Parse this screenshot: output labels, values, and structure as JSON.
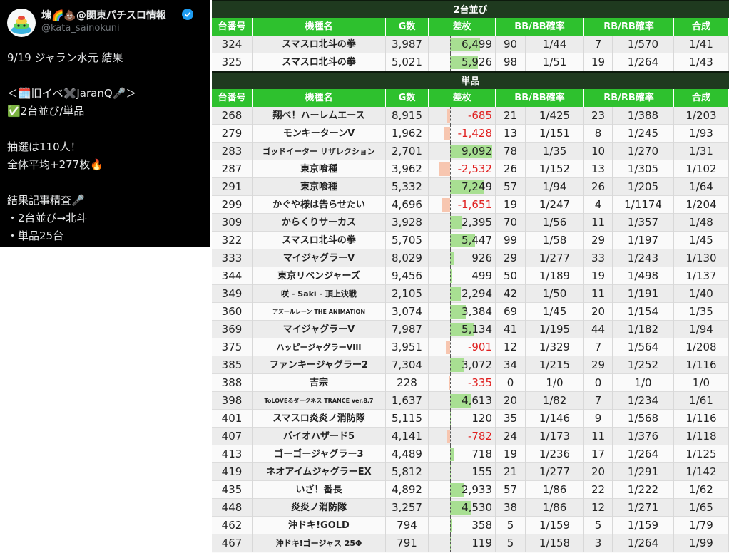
{
  "tweet": {
    "author_name": "塊🌈💩@関東パチスロ情報",
    "handle": "@kata_sainokuni",
    "lines": [
      "9/19 ジャラン水元 結果",
      "",
      "＜🗓️旧イベ✖️JaranQ🎤＞",
      "✅2台並び/単品",
      "",
      "抽選は110人！",
      "全体平均+277枚🔥",
      "",
      "結果記事精査🎤",
      "・2台並び→北斗",
      "・単品25台"
    ]
  },
  "columns": [
    "台番号",
    "機種名",
    "G数",
    "差枚",
    "BB/BB確率",
    "",
    "RB/RB確率",
    "",
    "合成"
  ],
  "sections": [
    {
      "title": "2台並び",
      "rows": [
        {
          "no": "324",
          "name": "スマスロ北斗の拳",
          "g": "3,987",
          "diff": "6,499",
          "diff_value": 6499,
          "bb": "90",
          "bb_rate": "1/44",
          "rb": "7",
          "rb_rate": "1/570",
          "total": "1/41"
        },
        {
          "no": "325",
          "name": "スマスロ北斗の拳",
          "g": "5,021",
          "diff": "5,926",
          "diff_value": 5926,
          "bb": "98",
          "bb_rate": "1/51",
          "rb": "19",
          "rb_rate": "1/264",
          "total": "1/43"
        }
      ]
    },
    {
      "title": "単品",
      "rows": [
        {
          "no": "268",
          "name": "翔べ！ハーレムエース",
          "g": "8,915",
          "diff": "-685",
          "diff_value": -685,
          "bb": "21",
          "bb_rate": "1/425",
          "rb": "23",
          "rb_rate": "1/388",
          "total": "1/203"
        },
        {
          "no": "279",
          "name": "モンキーターンV",
          "g": "1,962",
          "diff": "-1,428",
          "diff_value": -1428,
          "bb": "13",
          "bb_rate": "1/151",
          "rb": "8",
          "rb_rate": "1/245",
          "total": "1/93"
        },
        {
          "no": "283",
          "name": "ゴッドイーター リザレクション",
          "g": "2,701",
          "diff": "9,092",
          "diff_value": 9092,
          "bb": "78",
          "bb_rate": "1/35",
          "rb": "10",
          "rb_rate": "1/270",
          "total": "1/31"
        },
        {
          "no": "287",
          "name": "東京喰種",
          "g": "3,962",
          "diff": "-2,532",
          "diff_value": -2532,
          "bb": "26",
          "bb_rate": "1/152",
          "rb": "13",
          "rb_rate": "1/305",
          "total": "1/102"
        },
        {
          "no": "291",
          "name": "東京喰種",
          "g": "5,332",
          "diff": "7,249",
          "diff_value": 7249,
          "bb": "57",
          "bb_rate": "1/94",
          "rb": "26",
          "rb_rate": "1/205",
          "total": "1/64"
        },
        {
          "no": "299",
          "name": "かぐや様は告らせたい",
          "g": "4,696",
          "diff": "-1,651",
          "diff_value": -1651,
          "bb": "19",
          "bb_rate": "1/247",
          "rb": "4",
          "rb_rate": "1/1174",
          "total": "1/204"
        },
        {
          "no": "309",
          "name": "からくりサーカス",
          "g": "3,928",
          "diff": "2,395",
          "diff_value": 2395,
          "bb": "70",
          "bb_rate": "1/56",
          "rb": "11",
          "rb_rate": "1/357",
          "total": "1/48"
        },
        {
          "no": "322",
          "name": "スマスロ北斗の拳",
          "g": "5,705",
          "diff": "5,447",
          "diff_value": 5447,
          "bb": "99",
          "bb_rate": "1/58",
          "rb": "29",
          "rb_rate": "1/197",
          "total": "1/45"
        },
        {
          "no": "333",
          "name": "マイジャグラーV",
          "g": "8,029",
          "diff": "926",
          "diff_value": 926,
          "bb": "29",
          "bb_rate": "1/277",
          "rb": "33",
          "rb_rate": "1/243",
          "total": "1/130"
        },
        {
          "no": "344",
          "name": "東京リベンジャーズ",
          "g": "9,456",
          "diff": "499",
          "diff_value": 499,
          "bb": "50",
          "bb_rate": "1/189",
          "rb": "19",
          "rb_rate": "1/498",
          "total": "1/137"
        },
        {
          "no": "349",
          "name": "咲 - Saki - 頂上決戦",
          "g": "2,105",
          "diff": "2,294",
          "diff_value": 2294,
          "bb": "42",
          "bb_rate": "1/50",
          "rb": "11",
          "rb_rate": "1/191",
          "total": "1/40"
        },
        {
          "no": "360",
          "name": "アズールレーン THE ANIMATION",
          "g": "3,074",
          "diff": "3,384",
          "diff_value": 3384,
          "bb": "69",
          "bb_rate": "1/45",
          "rb": "20",
          "rb_rate": "1/154",
          "total": "1/35"
        },
        {
          "no": "369",
          "name": "マイジャグラーV",
          "g": "7,987",
          "diff": "5,134",
          "diff_value": 5134,
          "bb": "41",
          "bb_rate": "1/195",
          "rb": "44",
          "rb_rate": "1/182",
          "total": "1/94"
        },
        {
          "no": "375",
          "name": "ハッピージャグラーVIII",
          "g": "3,951",
          "diff": "-901",
          "diff_value": -901,
          "bb": "12",
          "bb_rate": "1/329",
          "rb": "7",
          "rb_rate": "1/564",
          "total": "1/208"
        },
        {
          "no": "385",
          "name": "ファンキージャグラー2",
          "g": "7,304",
          "diff": "3,072",
          "diff_value": 3072,
          "bb": "34",
          "bb_rate": "1/215",
          "rb": "29",
          "rb_rate": "1/252",
          "total": "1/116"
        },
        {
          "no": "388",
          "name": "吉宗",
          "g": "228",
          "diff": "-335",
          "diff_value": -335,
          "bb": "0",
          "bb_rate": "1/0",
          "rb": "0",
          "rb_rate": "1/0",
          "total": "1/0"
        },
        {
          "no": "398",
          "name": "ToLOVEるダークネス TRANCE ver.8.7",
          "g": "1,637",
          "diff": "4,613",
          "diff_value": 4613,
          "bb": "20",
          "bb_rate": "1/82",
          "rb": "7",
          "rb_rate": "1/234",
          "total": "1/61"
        },
        {
          "no": "401",
          "name": "スマスロ炎炎ノ消防隊",
          "g": "5,115",
          "diff": "120",
          "diff_value": 120,
          "bb": "35",
          "bb_rate": "1/146",
          "rb": "9",
          "rb_rate": "1/568",
          "total": "1/116"
        },
        {
          "no": "407",
          "name": "バイオハザード5",
          "g": "4,141",
          "diff": "-782",
          "diff_value": -782,
          "bb": "24",
          "bb_rate": "1/173",
          "rb": "11",
          "rb_rate": "1/376",
          "total": "1/118"
        },
        {
          "no": "413",
          "name": "ゴーゴージャグラー3",
          "g": "4,489",
          "diff": "718",
          "diff_value": 718,
          "bb": "19",
          "bb_rate": "1/236",
          "rb": "17",
          "rb_rate": "1/264",
          "total": "1/125"
        },
        {
          "no": "419",
          "name": "ネオアイムジャグラーEX",
          "g": "5,812",
          "diff": "155",
          "diff_value": 155,
          "bb": "21",
          "bb_rate": "1/277",
          "rb": "20",
          "rb_rate": "1/291",
          "total": "1/142"
        },
        {
          "no": "435",
          "name": "いざ！番長",
          "g": "4,892",
          "diff": "2,933",
          "diff_value": 2933,
          "bb": "57",
          "bb_rate": "1/86",
          "rb": "22",
          "rb_rate": "1/222",
          "total": "1/62"
        },
        {
          "no": "448",
          "name": "炎炎ノ消防隊",
          "g": "3,257",
          "diff": "4,530",
          "diff_value": 4530,
          "bb": "38",
          "bb_rate": "1/86",
          "rb": "12",
          "rb_rate": "1/271",
          "total": "1/65"
        },
        {
          "no": "462",
          "name": "沖ドキ!GOLD",
          "g": "794",
          "diff": "358",
          "diff_value": 358,
          "bb": "5",
          "bb_rate": "1/159",
          "rb": "5",
          "rb_rate": "1/159",
          "total": "1/79"
        },
        {
          "no": "467",
          "name": "沖ドキ!ゴージャス 25Φ",
          "g": "791",
          "diff": "119",
          "diff_value": 119,
          "bb": "5",
          "bb_rate": "1/158",
          "rb": "3",
          "rb_rate": "1/264",
          "total": "1/99"
        }
      ]
    }
  ],
  "colors": {
    "header_green": "#2ec12e",
    "section_dark": "#1f3a1f",
    "bar_positive": "#a8df92",
    "bar_negative": "#f7c6b0",
    "negative_text": "#e02020"
  }
}
